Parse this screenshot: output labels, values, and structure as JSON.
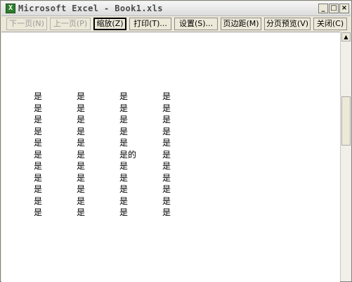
{
  "window": {
    "title": "Microsoft Excel - Book1.xls",
    "app_icon_glyph": "X",
    "controls": {
      "minimize": "_",
      "maximize": "□",
      "close": "×"
    }
  },
  "toolbar": {
    "buttons": [
      {
        "label": "下一页(N)",
        "enabled": false
      },
      {
        "label": "上一页(P)",
        "enabled": false
      },
      {
        "label": "缩放(Z)",
        "enabled": true,
        "active": true
      },
      {
        "label": "打印(T)...",
        "enabled": true
      },
      {
        "label": "设置(S)...",
        "enabled": true
      },
      {
        "label": "页边距(M)",
        "enabled": true
      },
      {
        "label": "分页预览(V)",
        "enabled": true
      },
      {
        "label": "关闭(C)",
        "enabled": true
      }
    ]
  },
  "sheet": {
    "columns": [
      [
        "是",
        "是",
        "是",
        "是",
        "是",
        "是",
        "是",
        "是",
        "是",
        "是",
        "是"
      ],
      [
        "是",
        "是",
        "是",
        "是",
        "是",
        "是",
        "是",
        "是",
        "是",
        "是",
        "是"
      ],
      [
        "是",
        "是",
        "是",
        "是",
        "是",
        "是的",
        "是",
        "是",
        "是",
        "是",
        "是"
      ],
      [
        "是",
        "是",
        "是",
        "是",
        "是",
        "是",
        "是",
        "是",
        "是",
        "是",
        "是"
      ]
    ]
  },
  "scrollbar": {
    "up_arrow": "▲"
  }
}
